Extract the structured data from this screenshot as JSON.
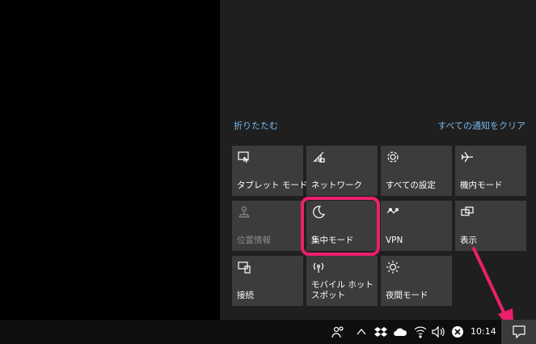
{
  "action_center": {
    "collapse_label": "折りたたむ",
    "clear_all_label": "すべての通知をクリア",
    "tiles": [
      {
        "label": "タブレット モード",
        "icon": "tablet-mode-icon",
        "enabled": true
      },
      {
        "label": "ネットワーク",
        "icon": "network-icon",
        "enabled": true
      },
      {
        "label": "すべての設定",
        "icon": "settings-gear-icon",
        "enabled": true
      },
      {
        "label": "機内モード",
        "icon": "airplane-icon",
        "enabled": true
      },
      {
        "label": "位置情報",
        "icon": "location-icon",
        "enabled": false
      },
      {
        "label": "集中モード",
        "icon": "moon-icon",
        "enabled": true
      },
      {
        "label": "VPN",
        "icon": "vpn-icon",
        "enabled": true
      },
      {
        "label": "表示",
        "icon": "display-icon",
        "enabled": true
      },
      {
        "label": "接続",
        "icon": "connect-icon",
        "enabled": true
      },
      {
        "label": "モバイル ホットスポット",
        "icon": "mobile-hotspot-icon",
        "enabled": true
      },
      {
        "label": "夜間モード",
        "icon": "night-light-icon",
        "enabled": true
      }
    ]
  },
  "taskbar": {
    "clock": "10:14",
    "tray_icons": [
      "people-icon",
      "chevron-up-icon",
      "dropbox-icon",
      "onedrive-icon",
      "wifi-icon",
      "volume-icon",
      "close-circle-icon"
    ],
    "action_center_icon": "notification-icon"
  },
  "colors": {
    "panel_bg": "#1f1f1f",
    "tile_bg": "#3c3c3c",
    "link": "#76b9ed",
    "highlight": "#ec1f6c",
    "taskbar_bg": "#0e0e0e"
  }
}
